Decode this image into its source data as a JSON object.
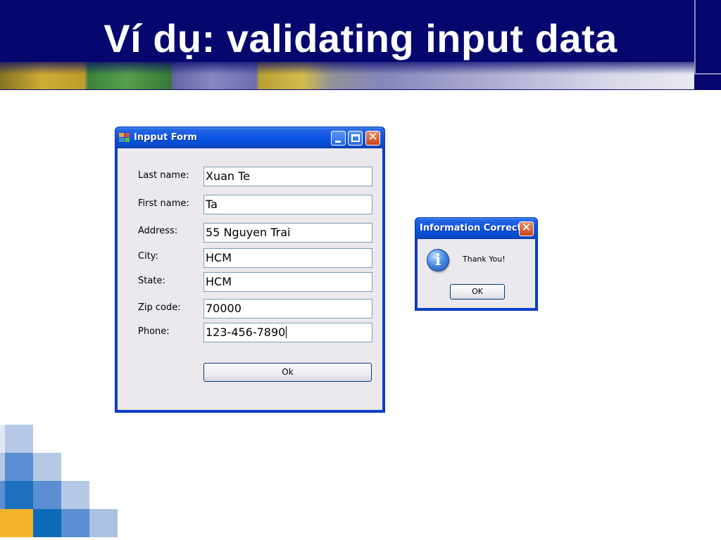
{
  "slide": {
    "title": "Ví dụ: validating input data",
    "colors": {
      "header_bg": "#06066f",
      "title_text": "#ffffff"
    }
  },
  "input_form": {
    "window_title": "Inpput Form",
    "icon": "app-window-icon",
    "controls": [
      "minimize-icon",
      "maximize-icon",
      "close-icon"
    ],
    "fields": [
      {
        "label": "Last name:",
        "value": "Xuan Te"
      },
      {
        "label": "First name:",
        "value": "Ta"
      },
      {
        "label": "Address:",
        "value": "55 Nguyen Trai"
      },
      {
        "label": "City:",
        "value": "HCM"
      },
      {
        "label": "State:",
        "value": "HCM"
      },
      {
        "label": "Zip code:",
        "value": "70000"
      },
      {
        "label": "Phone:",
        "value": "123-456-7890"
      }
    ],
    "ok_label": "Ok"
  },
  "message_box": {
    "window_title": "Information Correct",
    "icon": "info-icon",
    "icon_glyph": "i",
    "message": "Thank You!",
    "ok_label": "OK"
  }
}
